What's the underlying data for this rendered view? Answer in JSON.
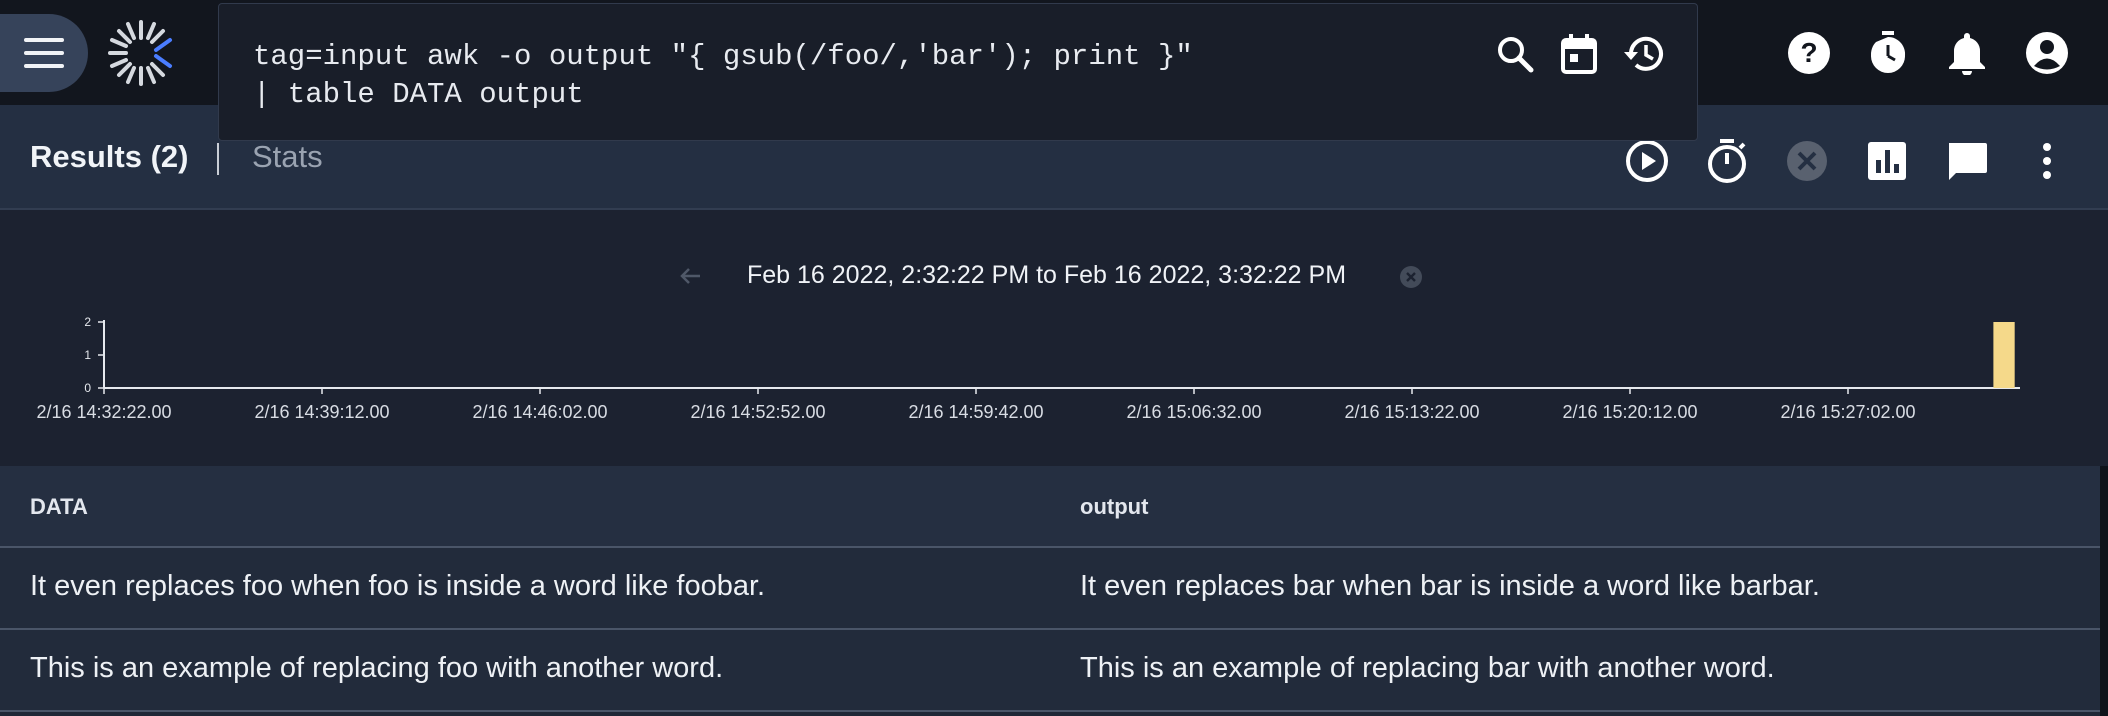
{
  "query": {
    "line1": "tag=input awk -o output \"{ gsub(/foo/,'bar'); print }\"",
    "line2": "| table DATA output",
    "actions": [
      "search-icon",
      "calendar-icon",
      "history-icon"
    ]
  },
  "topbar": {
    "icons": [
      "menu-icon",
      "help-icon",
      "timer-icon",
      "notifications-icon",
      "account-icon"
    ]
  },
  "tabs": {
    "results": "Results (2)",
    "stats": "Stats"
  },
  "toolbar": {
    "icons": [
      "play-icon",
      "stopwatch-icon",
      "cancel-icon",
      "chart-icon",
      "comment-icon",
      "more-vert-icon"
    ]
  },
  "timerange": {
    "text": "Feb 16 2022, 2:32:22 PM to Feb 16 2022, 3:32:22 PM"
  },
  "chart_data": {
    "type": "bar",
    "x_tick_labels": [
      "2/16 14:32:22.00",
      "2/16 14:39:12.00",
      "2/16 14:46:02.00",
      "2/16 14:52:52.00",
      "2/16 14:59:42.00",
      "2/16 15:06:32.00",
      "2/16 15:13:22.00",
      "2/16 15:20:12.00",
      "2/16 15:27:02.00"
    ],
    "y_ticks": [
      0,
      1,
      2
    ],
    "ylim": [
      0,
      2
    ],
    "xlim_seconds": [
      0,
      3600
    ],
    "bars": [
      {
        "x_seconds": 3570,
        "width_seconds": 40,
        "value": 2
      }
    ],
    "bar_color": "#f5d98a"
  },
  "table": {
    "headers": [
      "DATA",
      "output"
    ],
    "rows": [
      [
        "It even replaces foo when foo is inside a word like foobar.",
        "It even replaces bar when bar is inside a word like barbar."
      ],
      [
        "This is an example of replacing foo with another word.",
        "This is an example of replacing bar with another word."
      ]
    ]
  }
}
